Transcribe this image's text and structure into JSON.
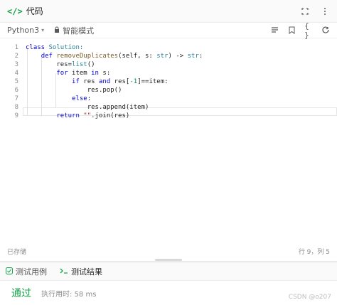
{
  "header": {
    "title": "代码",
    "code_icon": "</>"
  },
  "toolbar": {
    "language": "Python3",
    "mode": "智能模式"
  },
  "editor": {
    "line_numbers": [
      "1",
      "2",
      "3",
      "4",
      "5",
      "6",
      "7",
      "8",
      "9"
    ],
    "lines": [
      [
        {
          "t": "class ",
          "c": "kw"
        },
        {
          "t": "Solution:",
          "c": "cls"
        }
      ],
      [
        {
          "t": "    "
        },
        {
          "t": "def ",
          "c": "kw"
        },
        {
          "t": "removeDuplicates",
          "c": "fn"
        },
        {
          "t": "(self, s: "
        },
        {
          "t": "str",
          "c": "cls"
        },
        {
          "t": ") -> "
        },
        {
          "t": "str",
          "c": "cls"
        },
        {
          "t": ":"
        }
      ],
      [
        {
          "t": "        res="
        },
        {
          "t": "list",
          "c": "cls"
        },
        {
          "t": "()"
        }
      ],
      [
        {
          "t": "        "
        },
        {
          "t": "for ",
          "c": "kw"
        },
        {
          "t": "item "
        },
        {
          "t": "in ",
          "c": "kw"
        },
        {
          "t": "s:"
        }
      ],
      [
        {
          "t": "            "
        },
        {
          "t": "if ",
          "c": "kw"
        },
        {
          "t": "res "
        },
        {
          "t": "and ",
          "c": "kw"
        },
        {
          "t": "res["
        },
        {
          "t": "-1",
          "c": "num"
        },
        {
          "t": "]==item:"
        }
      ],
      [
        {
          "t": "                res.pop()"
        }
      ],
      [
        {
          "t": "            "
        },
        {
          "t": "else",
          "c": "kw"
        },
        {
          "t": ":"
        }
      ],
      [
        {
          "t": "                res.append(item)"
        }
      ],
      [
        {
          "t": "        "
        },
        {
          "t": "return ",
          "c": "kw"
        },
        {
          "t": "\"\"",
          "c": "str"
        },
        {
          "t": ".join(res)"
        }
      ]
    ]
  },
  "status": {
    "saved": "已存储",
    "position": "行 9，列 5"
  },
  "results": {
    "tab_testcases": "测试用例",
    "tab_result": "测试结果",
    "verdict": "通过",
    "runtime": "执行用时: 58 ms",
    "watermark": "CSDN @o207"
  },
  "colors": {
    "accent_green": "#16a34a",
    "keyword": "#0000d6"
  },
  "icons": [
    "code-icon",
    "maximize-icon",
    "lock-icon",
    "list-icon",
    "bookmark-icon",
    "braces-icon",
    "undo-icon",
    "checkbox-icon",
    "terminal-icon"
  ]
}
